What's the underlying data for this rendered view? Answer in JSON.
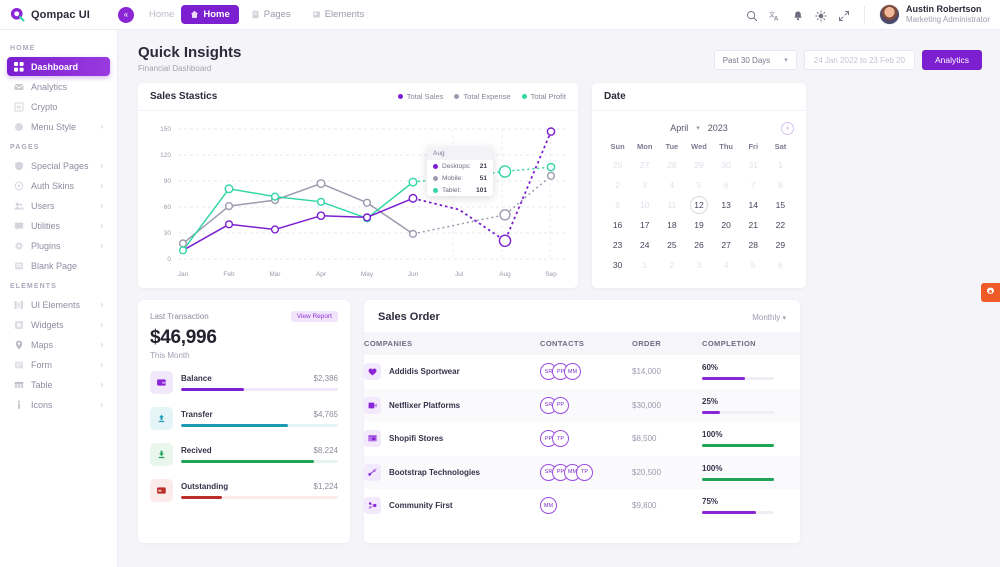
{
  "brand": {
    "name": "Qompac UI"
  },
  "topnav": {
    "collapse_icon": "chevrons-left-icon",
    "items": [
      {
        "label": "Home",
        "icon": "home-icon",
        "active": false,
        "muted": true
      },
      {
        "label": "Home",
        "icon": "home-icon",
        "active": true,
        "muted": false
      },
      {
        "label": "Pages",
        "icon": "pages-icon",
        "active": false,
        "muted": false
      },
      {
        "label": "Elements",
        "icon": "elements-icon",
        "active": false,
        "muted": false
      }
    ],
    "icons": [
      "search-icon",
      "translate-icon",
      "bell-icon",
      "sun-icon",
      "expand-icon"
    ],
    "user": {
      "name": "Austin Robertson",
      "role": "Marketing Administrator"
    }
  },
  "sidebar": {
    "sections": [
      {
        "label": "HOME",
        "items": [
          {
            "label": "Dashboard",
            "icon": "grid-icon",
            "active": true,
            "chevron": false
          },
          {
            "label": "Analytics",
            "icon": "analytics-icon",
            "active": false,
            "chevron": false
          },
          {
            "label": "Crypto",
            "icon": "crypto-icon",
            "active": false,
            "chevron": false
          },
          {
            "label": "Menu Style",
            "icon": "menu-style-icon",
            "active": false,
            "chevron": true
          }
        ]
      },
      {
        "label": "PAGES",
        "items": [
          {
            "label": "Special Pages",
            "icon": "shield-icon",
            "active": false,
            "chevron": true
          },
          {
            "label": "Auth Skins",
            "icon": "auth-icon",
            "active": false,
            "chevron": true
          },
          {
            "label": "Users",
            "icon": "users-icon",
            "active": false,
            "chevron": true
          },
          {
            "label": "Utilities",
            "icon": "utilities-icon",
            "active": false,
            "chevron": true
          },
          {
            "label": "Plugins",
            "icon": "plugins-icon",
            "active": false,
            "chevron": true
          },
          {
            "label": "Blank Page",
            "icon": "blank-page-icon",
            "active": false,
            "chevron": false
          }
        ]
      },
      {
        "label": "ELEMENTS",
        "items": [
          {
            "label": "UI Elements",
            "icon": "ui-elements-icon",
            "active": false,
            "chevron": true
          },
          {
            "label": "Widgets",
            "icon": "widgets-icon",
            "active": false,
            "chevron": true
          },
          {
            "label": "Maps",
            "icon": "map-pin-icon",
            "active": false,
            "chevron": true
          },
          {
            "label": "Form",
            "icon": "form-icon",
            "active": false,
            "chevron": true
          },
          {
            "label": "Table",
            "icon": "table-icon",
            "active": false,
            "chevron": true
          },
          {
            "label": "Icons",
            "icon": "info-icon",
            "active": false,
            "chevron": true
          }
        ]
      }
    ]
  },
  "page": {
    "title": "Quick Insights",
    "subtitle": "Financial Dashboard",
    "range_select": "Past 30 Days",
    "date_range_placeholder": "24 Jan 2022 to 23 Feb 20",
    "analytics_button": "Analytics"
  },
  "sales_statics": {
    "title": "Sales Stastics",
    "legend": [
      {
        "label": "Total Sales",
        "color": "#7b1fd1"
      },
      {
        "label": "Total Expense",
        "color": "#9b9bb0"
      },
      {
        "label": "Total Profit",
        "color": "#33d6a6"
      }
    ],
    "tooltip": {
      "title": "Aug",
      "rows": [
        {
          "label": "Desktops:",
          "value": "21",
          "color": "#7b1fd1"
        },
        {
          "label": "Mobile:",
          "value": "51",
          "color": "#9b9bb0"
        },
        {
          "label": "Tablet:",
          "value": "101",
          "color": "#33d6a6"
        }
      ]
    }
  },
  "chart_data": {
    "type": "line",
    "title": "Sales Stastics",
    "xlabel": "",
    "ylabel": "",
    "x": [
      "Jan",
      "Feb",
      "Mar",
      "Apr",
      "May",
      "Jun",
      "Jul",
      "Aug",
      "Sep"
    ],
    "yticks": [
      0,
      30,
      60,
      90,
      120,
      150
    ],
    "ylim": [
      0,
      150
    ],
    "grid": true,
    "legend_position": "top-right",
    "series": [
      {
        "name": "Total Sales",
        "color": "#7b1fd1",
        "values": [
          10,
          40,
          34,
          50,
          48,
          70,
          57,
          21,
          147
        ]
      },
      {
        "name": "Total Expense",
        "color": "#9b9bb0",
        "values": [
          18,
          61,
          68,
          87,
          65,
          29,
          40,
          51,
          96
        ]
      },
      {
        "name": "Total Profit",
        "color": "#33d6a6",
        "values": [
          10,
          81,
          72,
          66,
          47,
          89,
          95,
          101,
          106
        ]
      }
    ],
    "dashed_from": "Jun"
  },
  "date_card": {
    "title": "Date",
    "month": "April",
    "year": "2023",
    "next_icon": "chevron-right-icon",
    "dow": [
      "Sun",
      "Mon",
      "Tue",
      "Wed",
      "Thu",
      "Fri",
      "Sat"
    ],
    "selected": "12",
    "weeks": [
      [
        {
          "d": "26",
          "m": true
        },
        {
          "d": "27",
          "m": true
        },
        {
          "d": "28",
          "m": true
        },
        {
          "d": "29",
          "m": true
        },
        {
          "d": "30",
          "m": true
        },
        {
          "d": "31",
          "m": true
        },
        {
          "d": "1",
          "m": true
        }
      ],
      [
        {
          "d": "2",
          "m": true
        },
        {
          "d": "3",
          "m": true
        },
        {
          "d": "4",
          "m": true
        },
        {
          "d": "5",
          "m": true
        },
        {
          "d": "6",
          "m": true
        },
        {
          "d": "7",
          "m": true
        },
        {
          "d": "8",
          "m": true
        }
      ],
      [
        {
          "d": "9",
          "m": true
        },
        {
          "d": "10",
          "m": true
        },
        {
          "d": "11",
          "m": true
        },
        {
          "d": "12",
          "m": false
        },
        {
          "d": "13",
          "m": false
        },
        {
          "d": "14",
          "m": false
        },
        {
          "d": "15",
          "m": false
        }
      ],
      [
        {
          "d": "16",
          "m": false
        },
        {
          "d": "17",
          "m": false
        },
        {
          "d": "18",
          "m": false
        },
        {
          "d": "19",
          "m": false
        },
        {
          "d": "20",
          "m": false
        },
        {
          "d": "21",
          "m": false
        },
        {
          "d": "22",
          "m": false
        }
      ],
      [
        {
          "d": "23",
          "m": false
        },
        {
          "d": "24",
          "m": false
        },
        {
          "d": "25",
          "m": false
        },
        {
          "d": "26",
          "m": false
        },
        {
          "d": "27",
          "m": false
        },
        {
          "d": "28",
          "m": false
        },
        {
          "d": "29",
          "m": false
        }
      ],
      [
        {
          "d": "30",
          "m": false
        },
        {
          "d": "1",
          "m": true
        },
        {
          "d": "2",
          "m": true
        },
        {
          "d": "3",
          "m": true
        },
        {
          "d": "4",
          "m": true
        },
        {
          "d": "5",
          "m": true
        },
        {
          "d": "6",
          "m": true
        }
      ]
    ]
  },
  "last_transaction": {
    "label": "Last Transaction",
    "report_badge": "View Report",
    "amount": "$46,996",
    "period": "This Month",
    "items": [
      {
        "name": "Balance",
        "value": "$2,386",
        "icon": "wallet-icon",
        "pct": 40,
        "color": "#7b1fd1",
        "track": "#f0e7fa",
        "icon_bg": "#f2e8fc"
      },
      {
        "name": "Transfer",
        "value": "$4,765",
        "icon": "upload-icon",
        "pct": 68,
        "color": "#1c9ab4",
        "track": "#e4f4f7",
        "icon_bg": "#e4f4f7"
      },
      {
        "name": "Recived",
        "value": "$8,224",
        "icon": "download-icon",
        "pct": 85,
        "color": "#1da456",
        "track": "#e6f5eb",
        "icon_bg": "#e8f6ec"
      },
      {
        "name": "Outstanding",
        "value": "$1,224",
        "icon": "wallet-out-icon",
        "pct": 26,
        "color": "#bb2f2a",
        "track": "#fbeceb",
        "icon_bg": "#fbeceb"
      }
    ]
  },
  "sales_order": {
    "title": "Sales Order",
    "period": "Monthly",
    "columns": [
      "COMPANIES",
      "CONTACTS",
      "ORDER",
      "COMPLETION"
    ],
    "rows": [
      {
        "company": "Addidis Sportwear",
        "icon": "heart-icon",
        "contacts": [
          "SR",
          "PP",
          "MM"
        ],
        "order": "$14,000",
        "completion": "60%",
        "pct": 60,
        "bar_color": "#8b26d6"
      },
      {
        "company": "Netflixer Platforms",
        "icon": "video-icon",
        "contacts": [
          "SR",
          "PP"
        ],
        "order": "$30,000",
        "completion": "25%",
        "pct": 25,
        "bar_color": "#8b26d6"
      },
      {
        "company": "Shopifi Stores",
        "icon": "store-icon",
        "contacts": [
          "PP",
          "TP"
        ],
        "order": "$8,500",
        "completion": "100%",
        "pct": 100,
        "bar_color": "#1da456"
      },
      {
        "company": "Bootstrap Technologies",
        "icon": "bootstrap-icon",
        "contacts": [
          "SR",
          "PP",
          "MM",
          "TP"
        ],
        "order": "$20,500",
        "completion": "100%",
        "pct": 100,
        "bar_color": "#1da456"
      },
      {
        "company": "Community First",
        "icon": "community-icon",
        "contacts": [
          "MM"
        ],
        "order": "$9,800",
        "completion": "75%",
        "pct": 75,
        "bar_color": "#8b26d6"
      }
    ]
  },
  "fab": {
    "icon": "settings-gear-icon",
    "color": "#ef5b28"
  }
}
